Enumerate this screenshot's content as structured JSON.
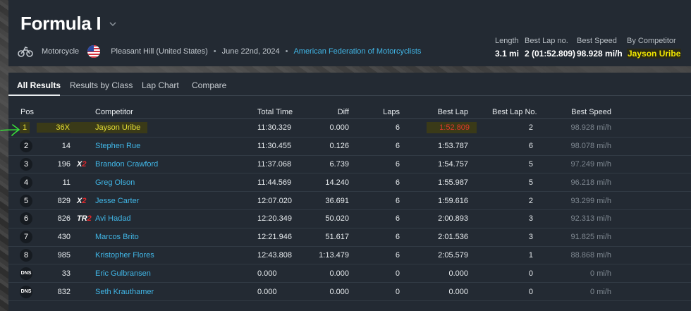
{
  "event": {
    "title": "Formula I",
    "vehicle_type": "Motorcycle",
    "location": "Pleasant Hill (United States)",
    "date": "June 22nd, 2024",
    "organization": "American Federation of Motorcyclists",
    "separator": "•"
  },
  "stats": {
    "length": {
      "label": "Length",
      "value": "3.1 mi"
    },
    "best_lap_no": {
      "label": "Best Lap no.",
      "value": "2 (01:52.809)"
    },
    "best_speed": {
      "label": "Best Speed",
      "value": "98.928 mi/h"
    },
    "by_competitor": {
      "label": "By Competitor",
      "value": "Jayson Uribe"
    }
  },
  "tabs": [
    {
      "label": "All Results",
      "active": true
    },
    {
      "label": "Results by Class",
      "active": false
    },
    {
      "label": "Lap Chart",
      "active": false
    },
    {
      "label": "Compare",
      "active": false
    }
  ],
  "columns": {
    "pos": "Pos",
    "competitor": "Competitor",
    "total_time": "Total Time",
    "diff": "Diff",
    "laps": "Laps",
    "best_lap": "Best Lap",
    "best_lap_no": "Best Lap No.",
    "best_speed": "Best Speed"
  },
  "rows": [
    {
      "pos": "1",
      "number": "36X",
      "class_badge": "",
      "competitor": "Jayson Uribe",
      "total_time": "11:30.329",
      "diff": "0.000",
      "laps": "6",
      "best_lap": "1:52.809",
      "best_lap_no": "2",
      "best_speed": "98.928 mi/h"
    },
    {
      "pos": "2",
      "number": "14",
      "class_badge": "",
      "competitor": "Stephen Rue",
      "total_time": "11:30.455",
      "diff": "0.126",
      "laps": "6",
      "best_lap": "1:53.787",
      "best_lap_no": "6",
      "best_speed": "98.078 mi/h"
    },
    {
      "pos": "3",
      "number": "196",
      "class_badge": "X2",
      "competitor": "Brandon Crawford",
      "total_time": "11:37.068",
      "diff": "6.739",
      "laps": "6",
      "best_lap": "1:54.757",
      "best_lap_no": "5",
      "best_speed": "97.249 mi/h"
    },
    {
      "pos": "4",
      "number": "11",
      "class_badge": "",
      "competitor": "Greg Olson",
      "total_time": "11:44.569",
      "diff": "14.240",
      "laps": "6",
      "best_lap": "1:55.987",
      "best_lap_no": "5",
      "best_speed": "96.218 mi/h"
    },
    {
      "pos": "5",
      "number": "829",
      "class_badge": "X2",
      "competitor": "Jesse Carter",
      "total_time": "12:07.020",
      "diff": "36.691",
      "laps": "6",
      "best_lap": "1:59.616",
      "best_lap_no": "2",
      "best_speed": "93.299 mi/h"
    },
    {
      "pos": "6",
      "number": "826",
      "class_badge": "TR2",
      "competitor": "Avi Hadad",
      "total_time": "12:20.349",
      "diff": "50.020",
      "laps": "6",
      "best_lap": "2:00.893",
      "best_lap_no": "3",
      "best_speed": "92.313 mi/h"
    },
    {
      "pos": "7",
      "number": "430",
      "class_badge": "",
      "competitor": "Marcos Brito",
      "total_time": "12:21.946",
      "diff": "51.617",
      "laps": "6",
      "best_lap": "2:01.536",
      "best_lap_no": "3",
      "best_speed": "91.825 mi/h"
    },
    {
      "pos": "8",
      "number": "985",
      "class_badge": "",
      "competitor": "Kristopher Flores",
      "total_time": "12:43.808",
      "diff": "1:13.479",
      "laps": "6",
      "best_lap": "2:05.579",
      "best_lap_no": "1",
      "best_speed": "88.868 mi/h"
    },
    {
      "pos": "DNS",
      "number": "33",
      "class_badge": "",
      "competitor": "Eric Gulbransen",
      "total_time": "0.000",
      "diff": "0.000",
      "laps": "0",
      "best_lap": "0.000",
      "best_lap_no": "0",
      "best_speed": "0 mi/h"
    },
    {
      "pos": "DNS",
      "number": "832",
      "class_badge": "",
      "competitor": "Seth Krauthamer",
      "total_time": "0.000",
      "diff": "0.000",
      "laps": "0",
      "best_lap": "0.000",
      "best_lap_no": "0",
      "best_speed": "0 mi/h"
    }
  ],
  "colors": {
    "panel_bg": "#232a33",
    "link": "#41b6e6",
    "highlight_yellow": "#f3e800",
    "best_lap_red": "#e03b2a",
    "class_red": "#e0272b",
    "annotation_green": "#39e03a"
  },
  "icons": {
    "vehicle": "motorcycle-icon",
    "flag": "us-flag-icon",
    "dropdown": "chevron-down-icon",
    "annotation": "hand-drawn-arrow-icon"
  }
}
